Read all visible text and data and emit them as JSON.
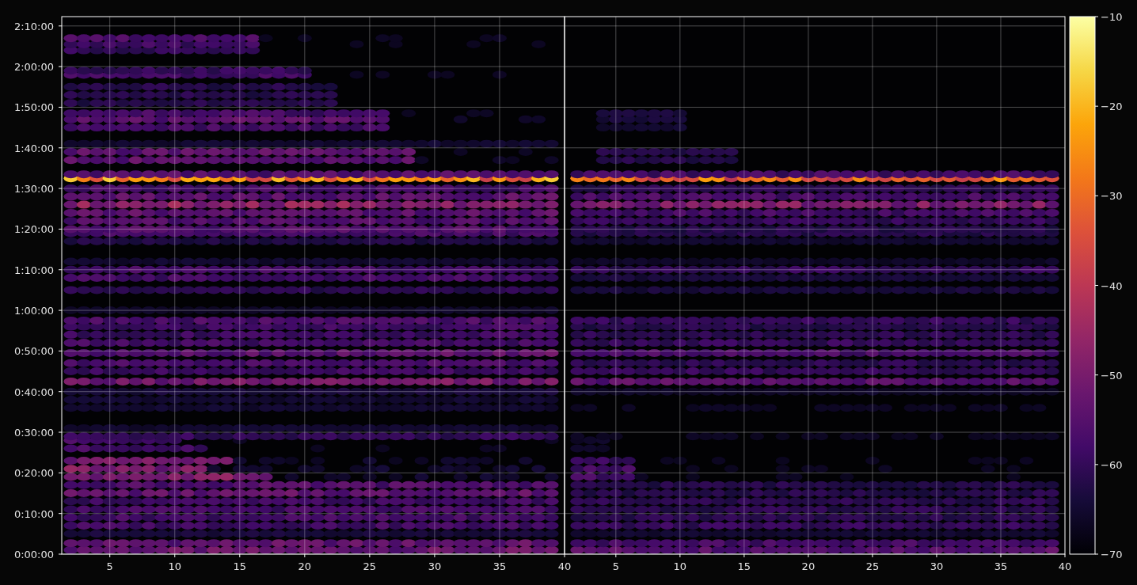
{
  "figure": {
    "panels": [
      {
        "xticks": [
          "5",
          "10",
          "15",
          "20",
          "25",
          "30",
          "35",
          "40"
        ]
      },
      {
        "xticks": [
          "5",
          "10",
          "15",
          "20",
          "25",
          "30",
          "35",
          "40"
        ]
      }
    ],
    "yticks": [
      "2:10:00",
      "2:00:00",
      "1:50:00",
      "1:40:00",
      "1:30:00",
      "1:20:00",
      "1:10:00",
      "1:00:00",
      "0:50:00",
      "0:40:00",
      "0:30:00",
      "0:20:00",
      "0:10:00",
      "0:00:00"
    ],
    "colorbar": {
      "ticks": [
        "−10",
        "−20",
        "−30",
        "−40",
        "−50",
        "−60",
        "−70"
      ]
    }
  }
}
